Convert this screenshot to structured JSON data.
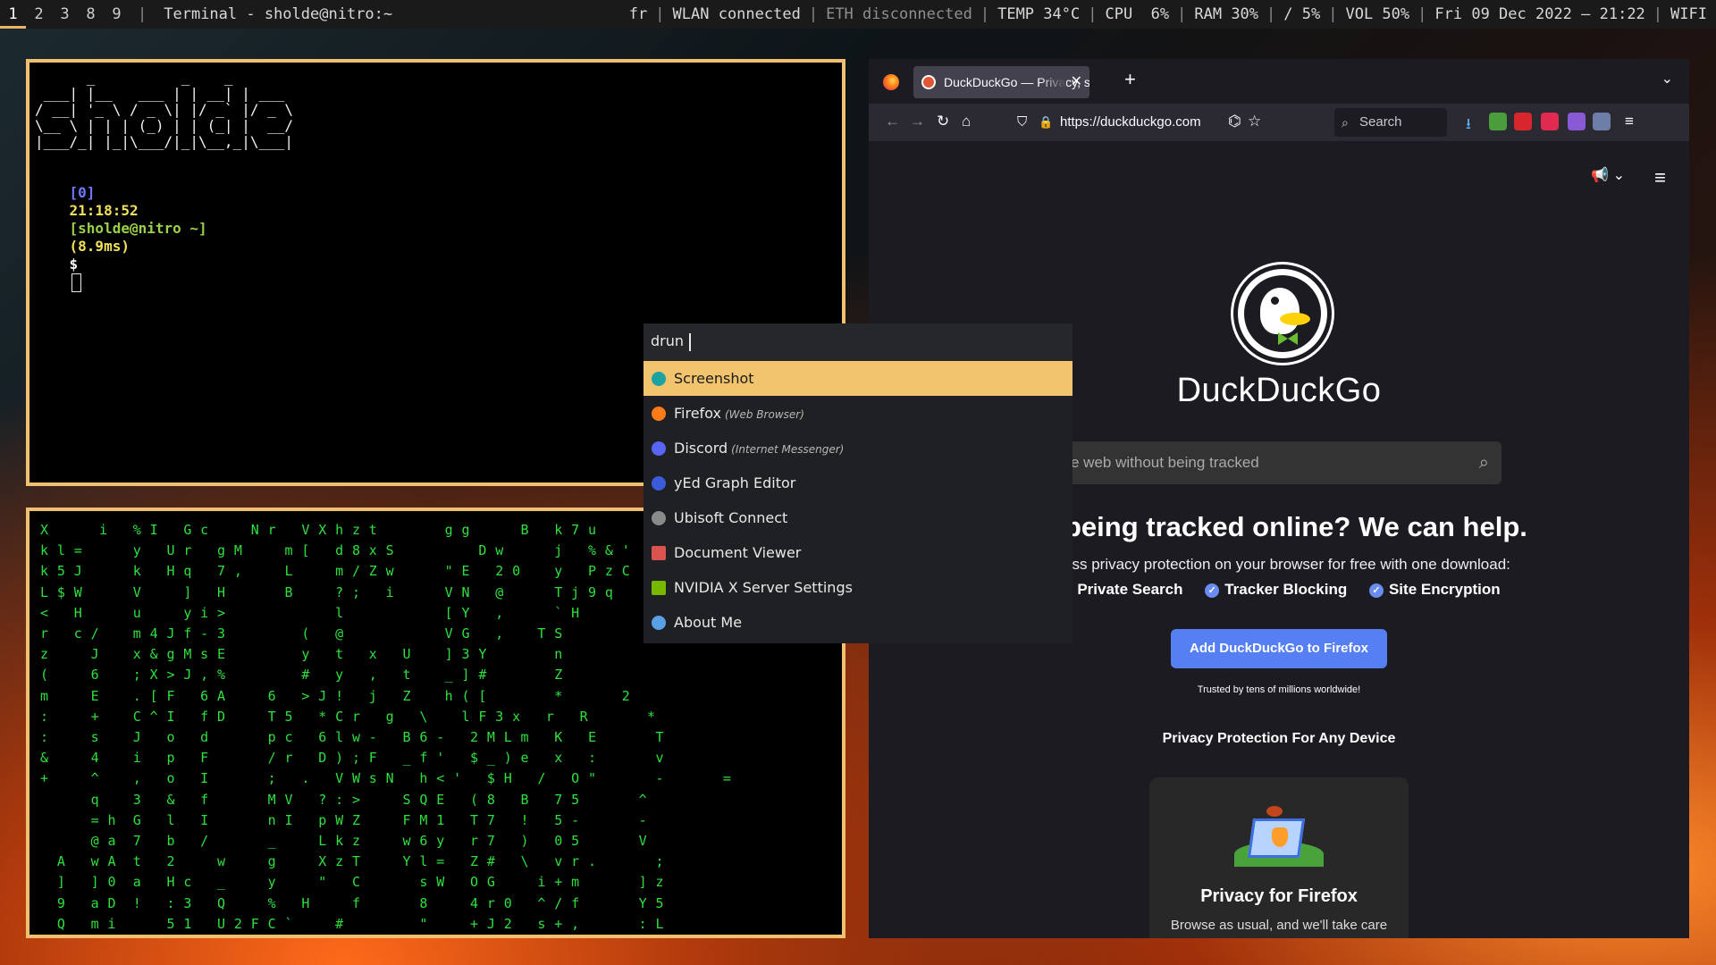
{
  "topbar": {
    "workspaces": [
      "1",
      "2",
      "3",
      "8",
      "9"
    ],
    "window_title": "Terminal - sholde@nitro:~",
    "status": {
      "layout": "fr",
      "wlan": "WLAN connected",
      "eth": "ETH disconnected",
      "temp": "TEMP 34°C",
      "cpu": "CPU  6%",
      "ram": "RAM 30%",
      "disk": "/ 5%",
      "vol": "VOL 50%",
      "datetime": "Fri 09 Dec 2022 — 21:22",
      "wifi": "WIFI"
    }
  },
  "terminal1": {
    "ascii_art": "      _          _    _\n ___| |__   ___ | | __| | ___\n/ __| '_ \\ / _ \\| |/ _` |/ _ \\\n\\__ \\ | | | (_) | | (_| |  __/\n|___/_| |_|\\___/|_|\\__,_|\\___|",
    "prompt": {
      "index": "[0]",
      "time": "21:18:52",
      "userhost": "[sholde@nitro ~]",
      "duration": "(8.9ms)",
      "sign": "$"
    }
  },
  "terminal2": {
    "matrix": "X      i   % I   G c     N r   V X h z t        g g      B   k 7 u\nk l =      y   U r   g M     m [   d 8 x S          D w      j   % & '\nk 5 J      k   H q   7 ,     L     m / Z w      \" E   2 0    y   P z C\nL $ W      V     ]   H       B     ? ;   i      V N   @      T j 9 q\n<   H      u     y i >             l            [ Y   ,      ` H\nr   c /    m 4 J f - 3         (   @            V G   ,    T S\nz     J    x & g M s E         y   t   x   U    ] 3 Y        n\n(     6    ; X > J , %         #   y   ,   t    _ ] #        Z\nm     E    . [ F   6 A     6   > J !   j   Z    h ( [        *       2\n:     +    C ^ I   f D     T 5   * C r   g   \\    l F 3 x   r   R       *\n:     s    J   o   d       p c   6 l w -   B 6 -   2 M L m   K   E       T\n&     4    i   p   F       / r   D ) ; F   _ f '   $ _ ) e   x   :       v\n+     ^    ,   o   I       ;   .   V W s N   h < '   $ H   /   O \"       -       =\n      q    3   &   f       M V   ? : >     S Q E   ( 8   B   7 5       ^\n      = h  G   l   I       n I   p W Z     F M 1   T 7   !   5 -       -\n      @ a  7   b   /       _     L k z     w 6 y   r 7   )   0 5       V\n  A   w A  t   2     w     g     X z T     Y l =   Z #   \\   v r .       ;\n  ]   ] 0  a   H c   _     y     \"   C       s W   O G     i + m       ] z\n  9   a D  !   : 3   Q     %   H     f       8     4 r 0   ^ / f       Y 5\n  Q   m i      5 1   U 2 F C `     #         \"     + J 2   s + ,       : L"
  },
  "firefox": {
    "tab_title": "DuckDuckGo — Privacy, s",
    "url": "https://duckduckgo.com",
    "search_placeholder": "Search",
    "page": {
      "brand": "DuckDuckGo",
      "search_placeholder": "e web without being tracked",
      "heading": "of being tracked online? We can help.",
      "subheading": "mless privacy protection on your browser for free with one download:",
      "checks": [
        "Private Search",
        "Tracker Blocking",
        "Site Encryption"
      ],
      "cta": "Add DuckDuckGo to Firefox",
      "trust": "Trusted by tens of millions worldwide!",
      "section_title": "Privacy Protection For Any Device",
      "card_title": "Privacy for Firefox",
      "card_body": "Browse as usual, and we'll take care of the rest. We bundled our search engine, tracker blocker,"
    }
  },
  "launcher": {
    "mode": "drun",
    "items": [
      {
        "label": "Screenshot",
        "category": "",
        "icon_color": "#1aa3a0"
      },
      {
        "label": "Firefox",
        "category": "(Web Browser)",
        "icon_color": "#ff7a18"
      },
      {
        "label": "Discord",
        "category": "(Internet Messenger)",
        "icon_color": "#5865f2"
      },
      {
        "label": "yEd Graph Editor",
        "category": "",
        "icon_color": "#3b5bdb"
      },
      {
        "label": "Ubisoft Connect",
        "category": "",
        "icon_color": "#8a8a8a"
      },
      {
        "label": "Document Viewer",
        "category": "",
        "icon_color": "#d9534f"
      },
      {
        "label": "NVIDIA X Server Settings",
        "category": "",
        "icon_color": "#76b900"
      },
      {
        "label": "About Me",
        "category": "",
        "icon_color": "#5aa0e6"
      }
    ]
  }
}
